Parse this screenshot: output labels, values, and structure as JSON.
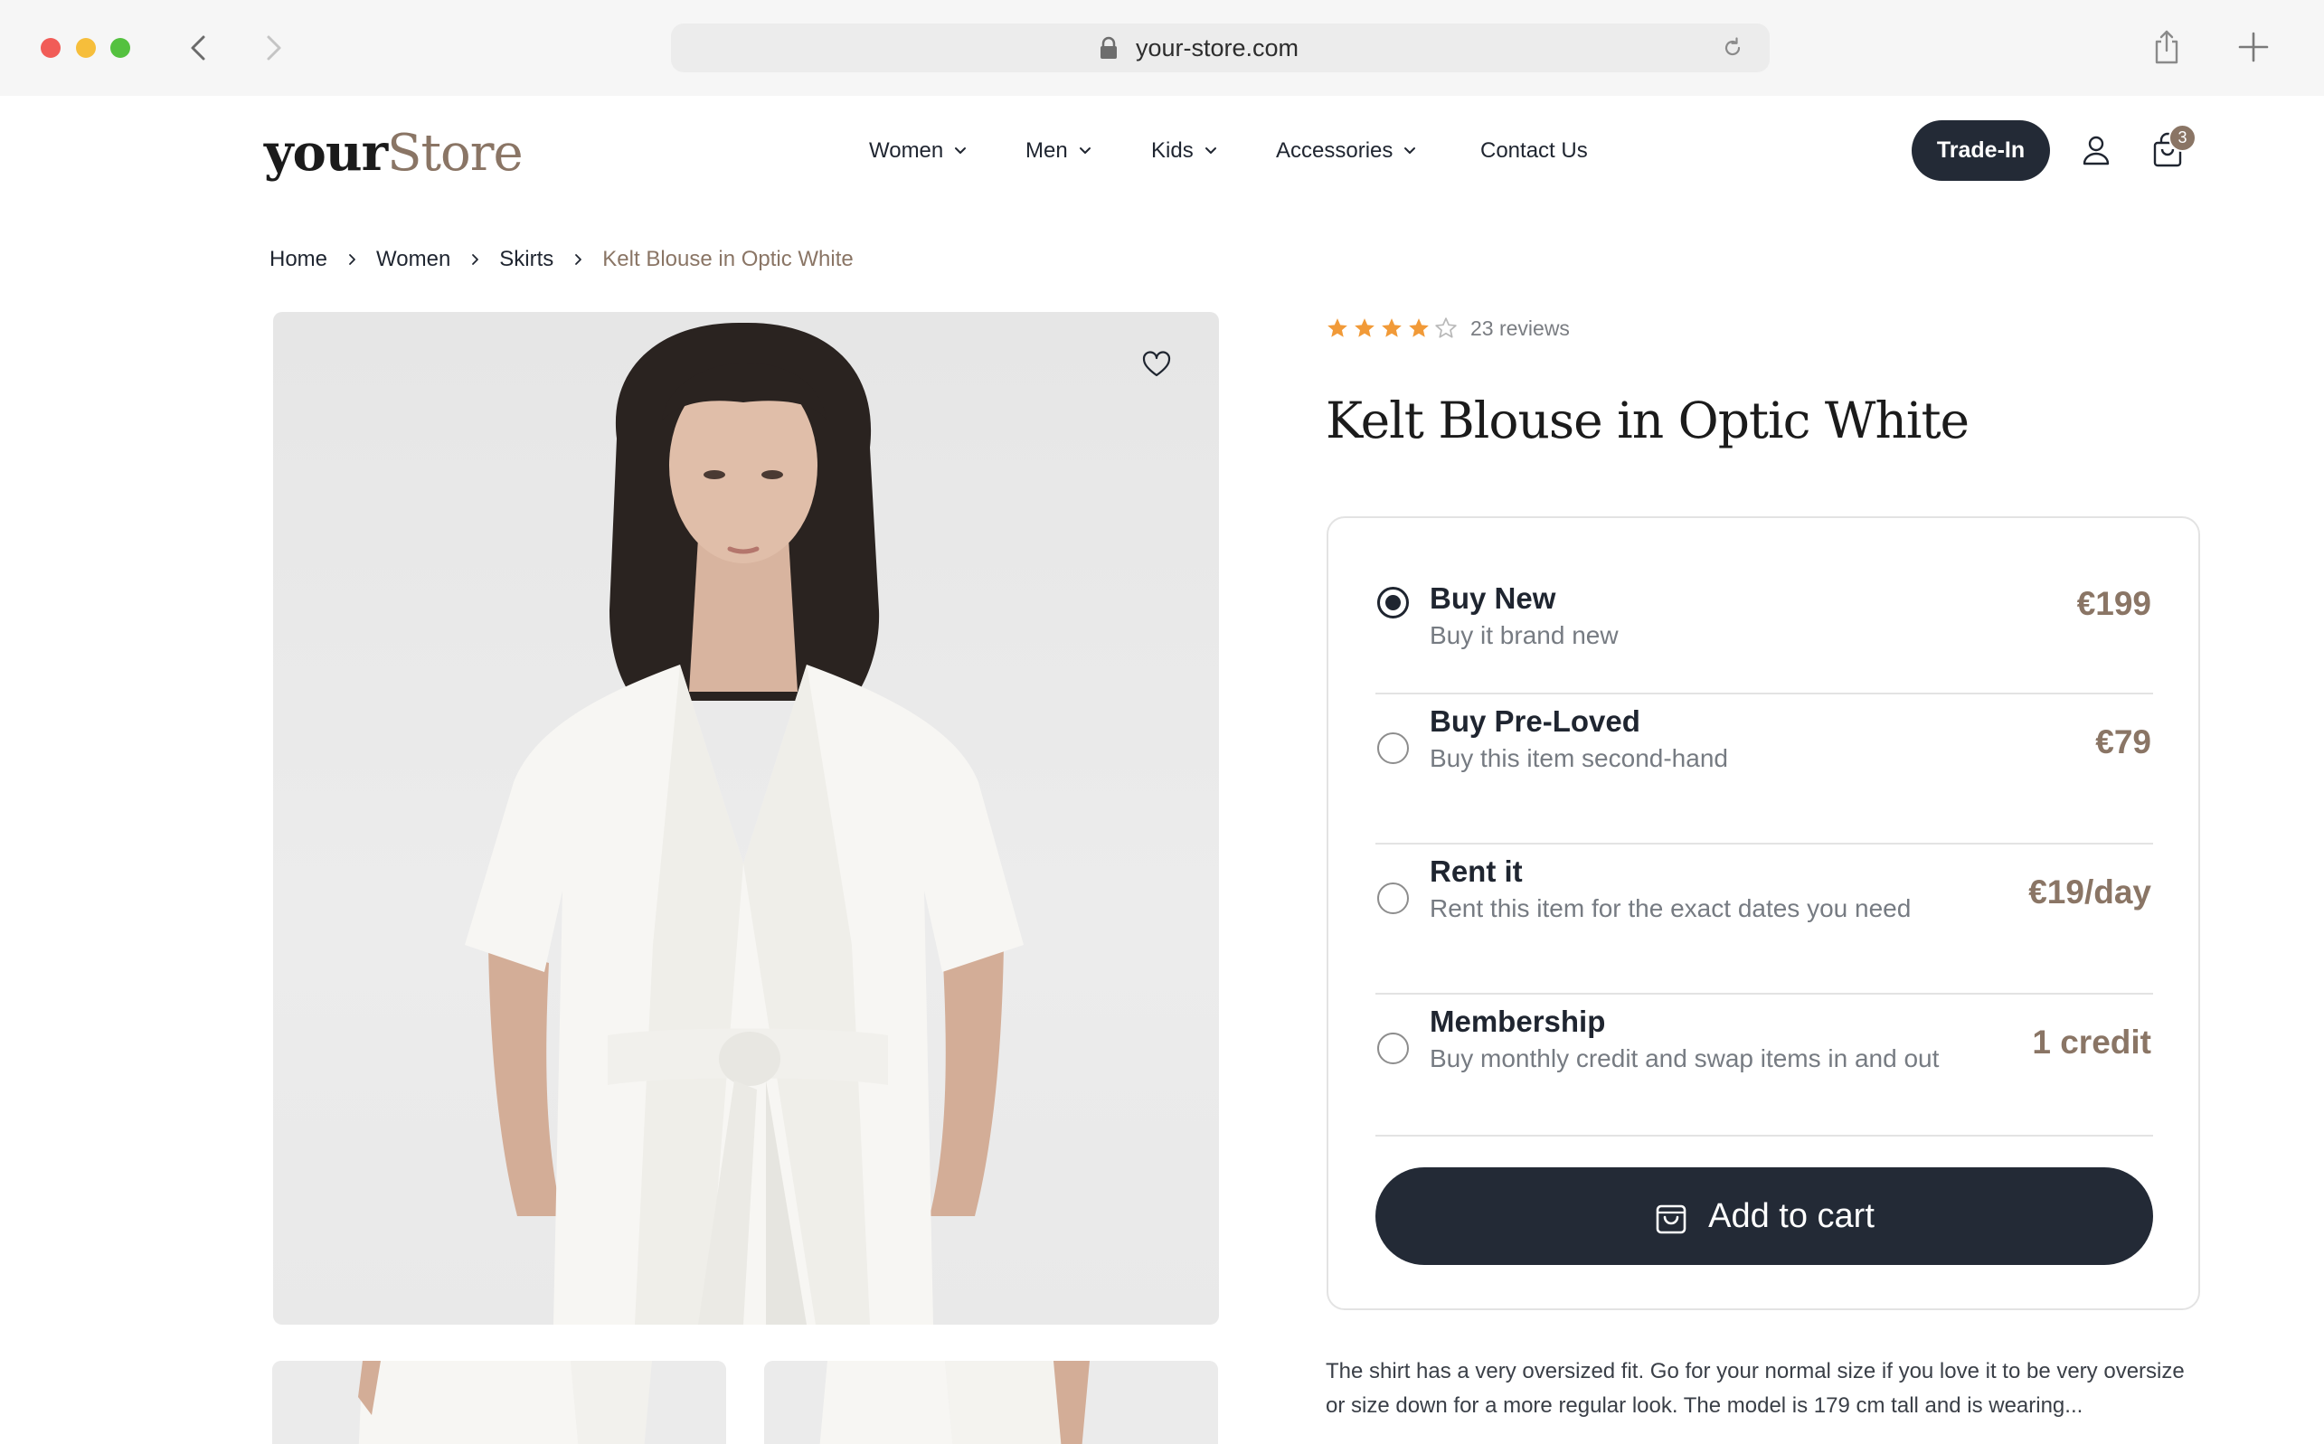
{
  "browser": {
    "url": "your-store.com"
  },
  "site": {
    "logo_part1": "your",
    "logo_part2": "Store",
    "nav": [
      {
        "label": "Women",
        "has_dropdown": true
      },
      {
        "label": "Men",
        "has_dropdown": true
      },
      {
        "label": "Kids",
        "has_dropdown": true
      },
      {
        "label": "Accessories",
        "has_dropdown": true
      },
      {
        "label": "Contact Us",
        "has_dropdown": false
      }
    ],
    "trade_in_label": "Trade-In",
    "cart_count": "3"
  },
  "breadcrumb": [
    "Home",
    "Women",
    "Skirts",
    "Kelt Blouse in Optic White"
  ],
  "product": {
    "rating": 4,
    "rating_max": 5,
    "reviews_label": "23 reviews",
    "title": "Kelt Blouse in Optic White",
    "options": [
      {
        "name": "Buy New",
        "desc": "Buy it brand new",
        "price": "€199",
        "selected": true
      },
      {
        "name": "Buy Pre-Loved",
        "desc": "Buy this item second-hand",
        "price": "€79",
        "selected": false
      },
      {
        "name": "Rent it",
        "desc": "Rent this item for the exact dates you need",
        "price": "€19/day",
        "selected": false
      },
      {
        "name": "Membership",
        "desc": "Buy monthly credit and swap items in and out",
        "price": "1 credit",
        "selected": false
      }
    ],
    "add_to_cart_label": "Add to cart",
    "description": "The shirt has a very oversized fit. Go for your normal size if you love it to be very oversize or size down for a more regular look. The model is 179 cm tall and is wearing..."
  },
  "colors": {
    "accent": "#8a7565",
    "dark": "#232a36",
    "star": "#f19a38"
  },
  "icons": {
    "back": "chevron-left-icon",
    "forward": "chevron-right-icon",
    "lock": "lock-icon",
    "reload": "reload-icon",
    "share": "share-icon",
    "new_tab": "plus-icon",
    "account": "user-icon",
    "cart": "shopping-bag-icon",
    "wishlist": "heart-icon"
  }
}
